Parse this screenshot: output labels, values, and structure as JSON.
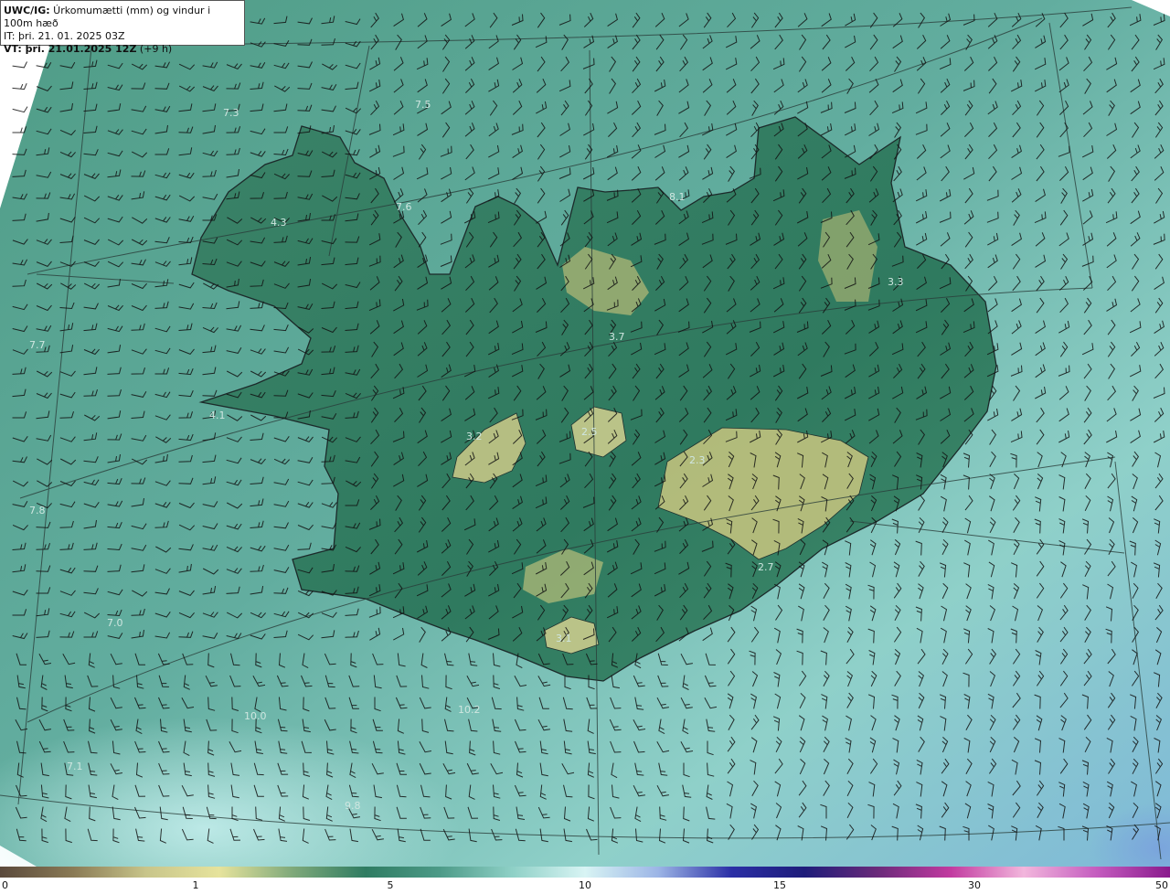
{
  "header": {
    "line1_bold": "UWC/IG:",
    "line1_text": " Úrkomumætti (mm) og vindur i 100m hæð",
    "line2_bold": "IT:",
    "line2_text": " þri. 21. 01. 2025 03Z",
    "line3_bold": "VT: þri. 21.01.2025 12Z",
    "line3_text": " (+9 h)"
  },
  "map_labels": [
    "7.3",
    "7.5",
    "4.3",
    "7.6",
    "8.1",
    "3.3",
    "3.7",
    "7.7",
    "4.1",
    "3.2",
    "2.5",
    "2.3",
    "7.8",
    "2.7",
    "7.0",
    "3.1",
    "10.0",
    "10.2",
    "7.1",
    "9.8"
  ],
  "colorbar": {
    "ticks": [
      "0",
      "1",
      "5",
      "10",
      "15",
      "30",
      "50"
    ],
    "colors": [
      "#5b4a3c",
      "#8a7a55",
      "#c8c58a",
      "#e6e39c",
      "#7fa97a",
      "#2f7c62",
      "#4c9a87",
      "#8ed0c6",
      "#d8f4f4",
      "#9cb5e6",
      "#2b2fa6",
      "#1e1c7a",
      "#6a2a7a",
      "#c23aa0",
      "#f2b6dc",
      "#c45cbf",
      "#8a1a8c"
    ]
  },
  "colors": {
    "land_low": "#3c8569",
    "land_high": "#c9cc8a",
    "sea": "#5aa597",
    "coastline": "#1c2a2a"
  }
}
